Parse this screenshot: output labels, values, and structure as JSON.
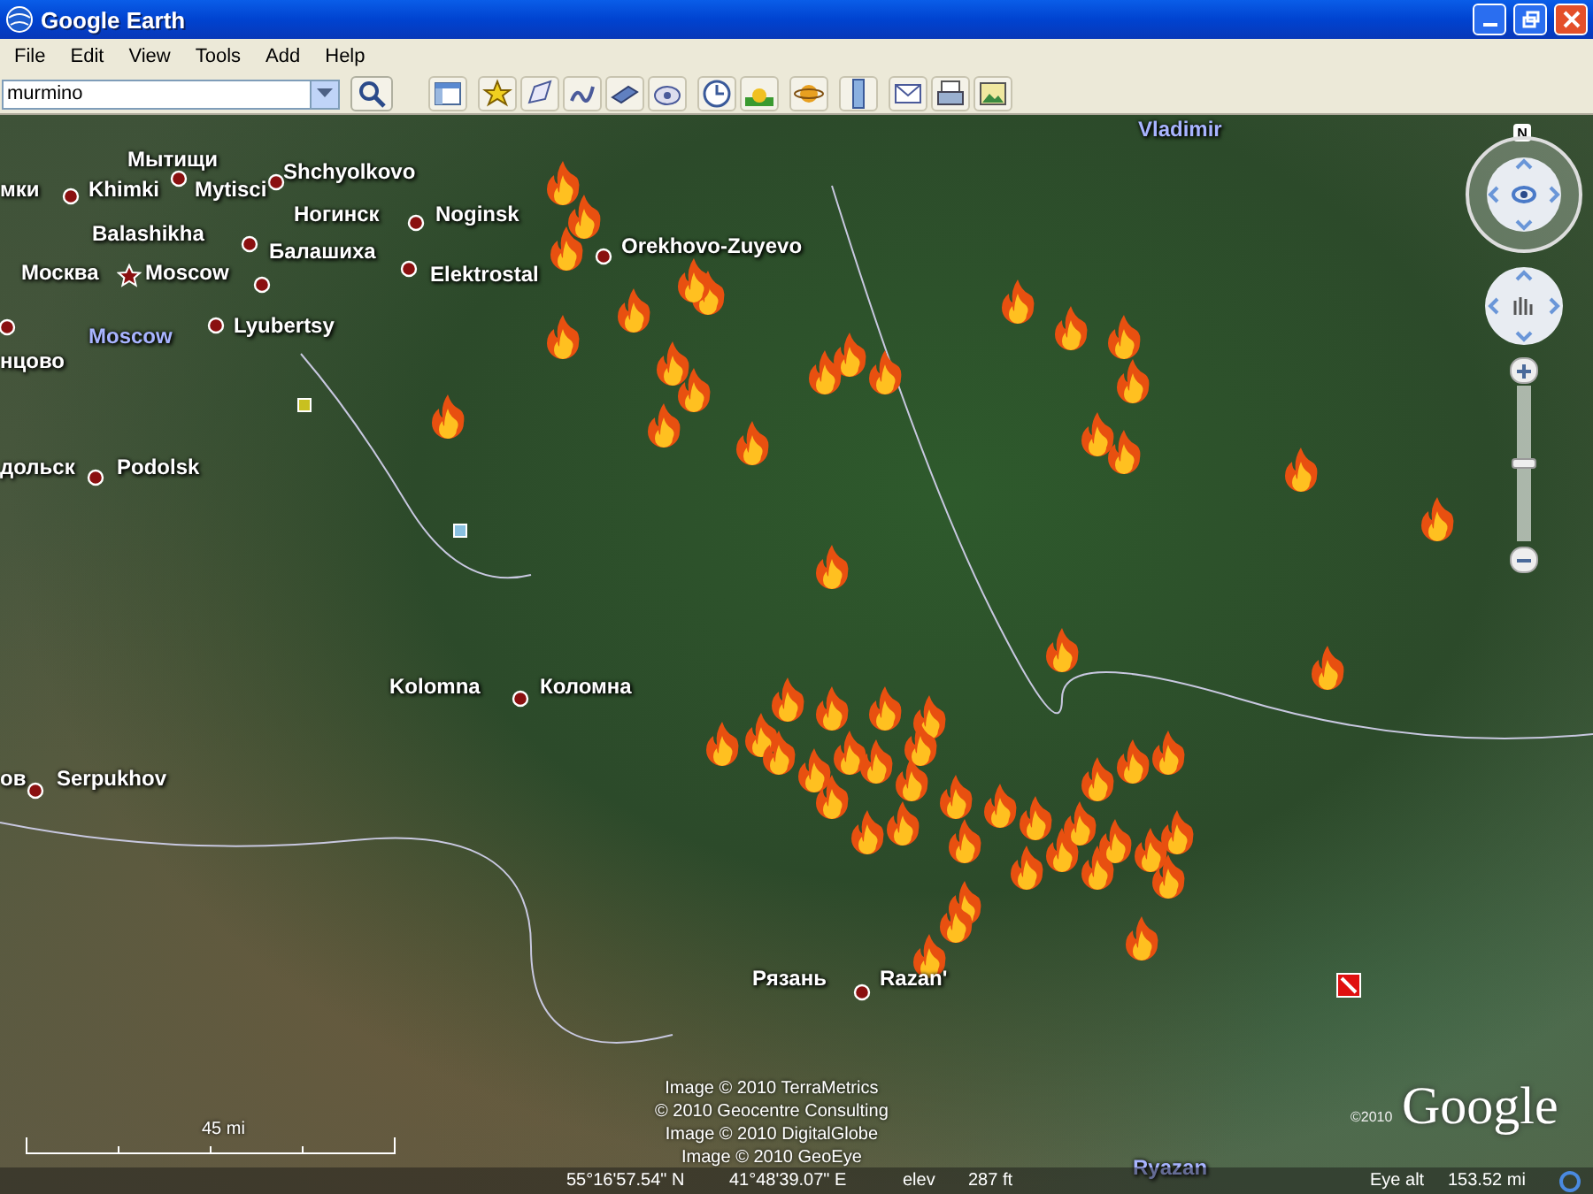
{
  "window": {
    "title": "Google Earth"
  },
  "menu": [
    "File",
    "Edit",
    "View",
    "Tools",
    "Add",
    "Help"
  ],
  "search": {
    "value": "murmino"
  },
  "map": {
    "labels": [
      {
        "text": "мки",
        "kind": "city"
      },
      {
        "text": "Khimki",
        "kind": "city"
      },
      {
        "text": "Мытищи",
        "kind": "city"
      },
      {
        "text": "Mytisci",
        "kind": "city"
      },
      {
        "text": "Shchyolkovo",
        "kind": "city"
      },
      {
        "text": "Ногинск",
        "kind": "city"
      },
      {
        "text": "Noginsk",
        "kind": "city"
      },
      {
        "text": "Balashikha",
        "kind": "city"
      },
      {
        "text": "Балашиха",
        "kind": "city"
      },
      {
        "text": "Elektrostal",
        "kind": "city"
      },
      {
        "text": "Orekhovo-Zuyevo",
        "kind": "city"
      },
      {
        "text": "Москва",
        "kind": "city"
      },
      {
        "text": "Moscow",
        "kind": "city"
      },
      {
        "text": "Moscow",
        "kind": "region"
      },
      {
        "text": "Lyubertsy",
        "kind": "city"
      },
      {
        "text": "нцово",
        "kind": "city"
      },
      {
        "text": "дольск",
        "kind": "city"
      },
      {
        "text": "Podolsk",
        "kind": "city"
      },
      {
        "text": "Vladimir",
        "kind": "region"
      },
      {
        "text": "Kolomna",
        "kind": "city"
      },
      {
        "text": "Коломна",
        "kind": "city"
      },
      {
        "text": "ов",
        "kind": "city"
      },
      {
        "text": "Serpukhov",
        "kind": "city"
      },
      {
        "text": "Рязань",
        "kind": "city"
      },
      {
        "text": "Razan'",
        "kind": "city"
      },
      {
        "text": "Ryazan",
        "kind": "region"
      }
    ],
    "compass_letter": "N",
    "zoom_slider": {
      "level": 0.5
    },
    "scale": "45 mi",
    "attribution": [
      "Image © 2010 TerraMetrics",
      "© 2010 Geocentre Consulting",
      "Image © 2010 DigitalGlobe",
      "Image © 2010 GeoEye"
    ],
    "logo_year": "©2010",
    "logo": "Google",
    "status": {
      "latitude": "55°16'57.54\" N",
      "longitude": "41°48'39.07\" E",
      "elev_label": "elev",
      "elev": "287 ft",
      "eye_label": "Eye alt",
      "eye": "153.52 mi"
    }
  }
}
